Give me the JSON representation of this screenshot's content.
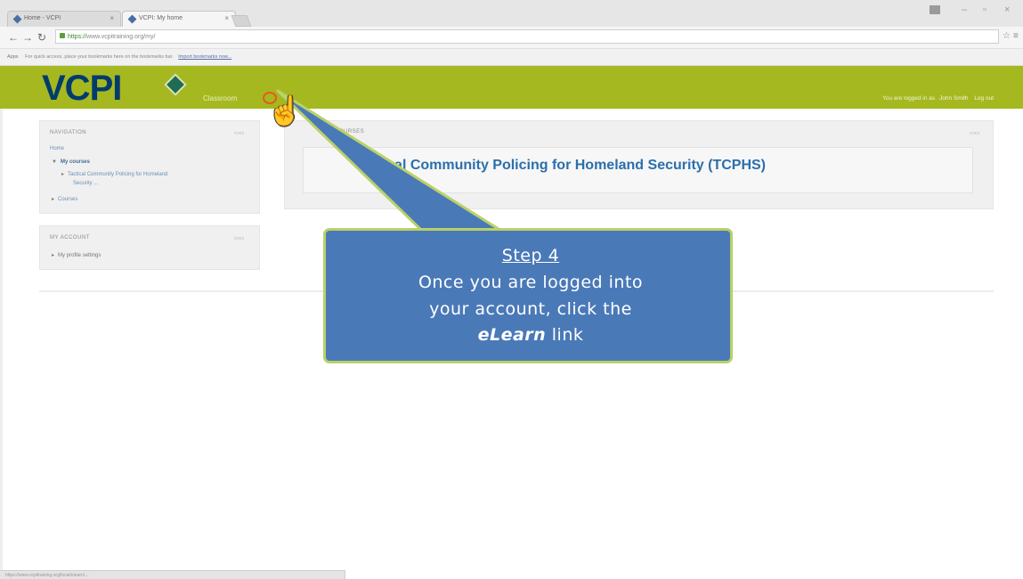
{
  "browser": {
    "tabs": [
      {
        "label": "Home - VCPI"
      },
      {
        "label": "VCPI: My home"
      }
    ],
    "url": {
      "scheme": "https://",
      "host": "www.vcpitraining.org",
      "path": "/my/"
    },
    "bookmarks_bar": {
      "apps_label": "Apps",
      "prompt": "For quick access, place your bookmarks here on the bookmarks bar.",
      "import_link": "Import bookmarks now..."
    },
    "status_url": "https://www.vcpitraining.org/local/elearn/..."
  },
  "site": {
    "logo_text": "VCPI",
    "nav": {
      "classroom": "Classroom"
    },
    "login": {
      "prefix": "You are logged in as",
      "user": "John Smith",
      "logout": "Log out"
    }
  },
  "navigation_block": {
    "title": "NAVIGATION",
    "home": "Home",
    "my_courses": "My courses",
    "course_item_line1": "Tactical Community Policing for Homeland",
    "course_item_line2": "Security ...",
    "courses": "Courses"
  },
  "account_block": {
    "title": "MY ACCOUNT",
    "profile_settings": "My profile settings"
  },
  "courses_block": {
    "label": "COURSES",
    "course_title": "Tactical Community Policing for Homeland Security (TCPHS)"
  },
  "callout": {
    "step": "Step 4",
    "line1": "Once you are logged into",
    "line2": "your account, click the",
    "emphasis": "eLearn",
    "line3_suffix": " link"
  },
  "colors": {
    "header_green": "#a6b81f",
    "logo_blue": "#003b6e",
    "callout_blue": "#4a79b8",
    "callout_border": "#b9d168",
    "link_blue": "#2b6fab",
    "highlight_orange": "#e65b1a"
  },
  "icons": [
    "cursor-hand-icon",
    "back-arrow-icon",
    "forward-arrow-icon",
    "reload-icon",
    "lock-icon",
    "star-icon",
    "menu-icon"
  ]
}
